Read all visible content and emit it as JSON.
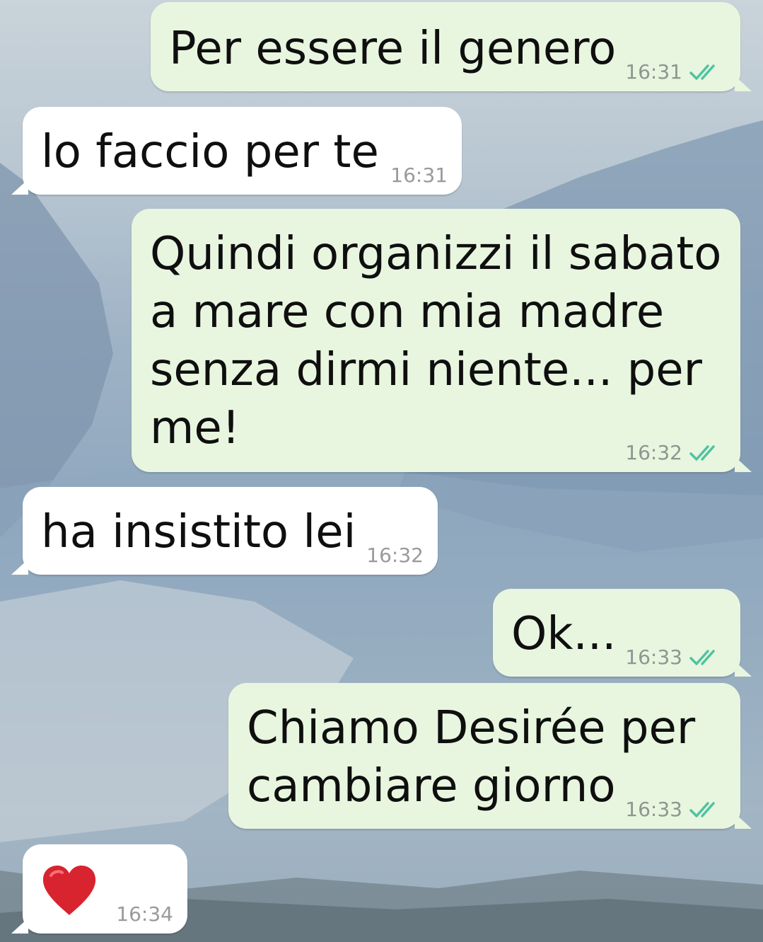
{
  "colors": {
    "outgoing_bubble": "#e8f6e0",
    "incoming_bubble": "#ffffff",
    "read_ticks": "#4fc3a1",
    "timestamp": "#8d9690"
  },
  "messages": [
    {
      "direction": "outgoing",
      "text": "Per essere il genero",
      "time": "16:31",
      "status": "read-double-check-icon"
    },
    {
      "direction": "incoming",
      "text": "lo faccio per te",
      "time": "16:31"
    },
    {
      "direction": "outgoing",
      "lines": [
        "Quindi organizzi il sabato",
        "a mare con mia madre",
        "senza dirmi niente... per",
        "me!"
      ],
      "time": "16:32",
      "status": "read-double-check-icon"
    },
    {
      "direction": "incoming",
      "text": "ha insistito lei",
      "time": "16:32"
    },
    {
      "direction": "outgoing",
      "text": "Ok...",
      "time": "16:33",
      "status": "read-double-check-icon"
    },
    {
      "direction": "outgoing",
      "lines": [
        "Chiamo Desirée per",
        "cambiare giorno"
      ],
      "time": "16:33",
      "status": "read-double-check-icon"
    },
    {
      "direction": "incoming",
      "emoji": "red-heart-icon",
      "time": "16:34"
    }
  ]
}
